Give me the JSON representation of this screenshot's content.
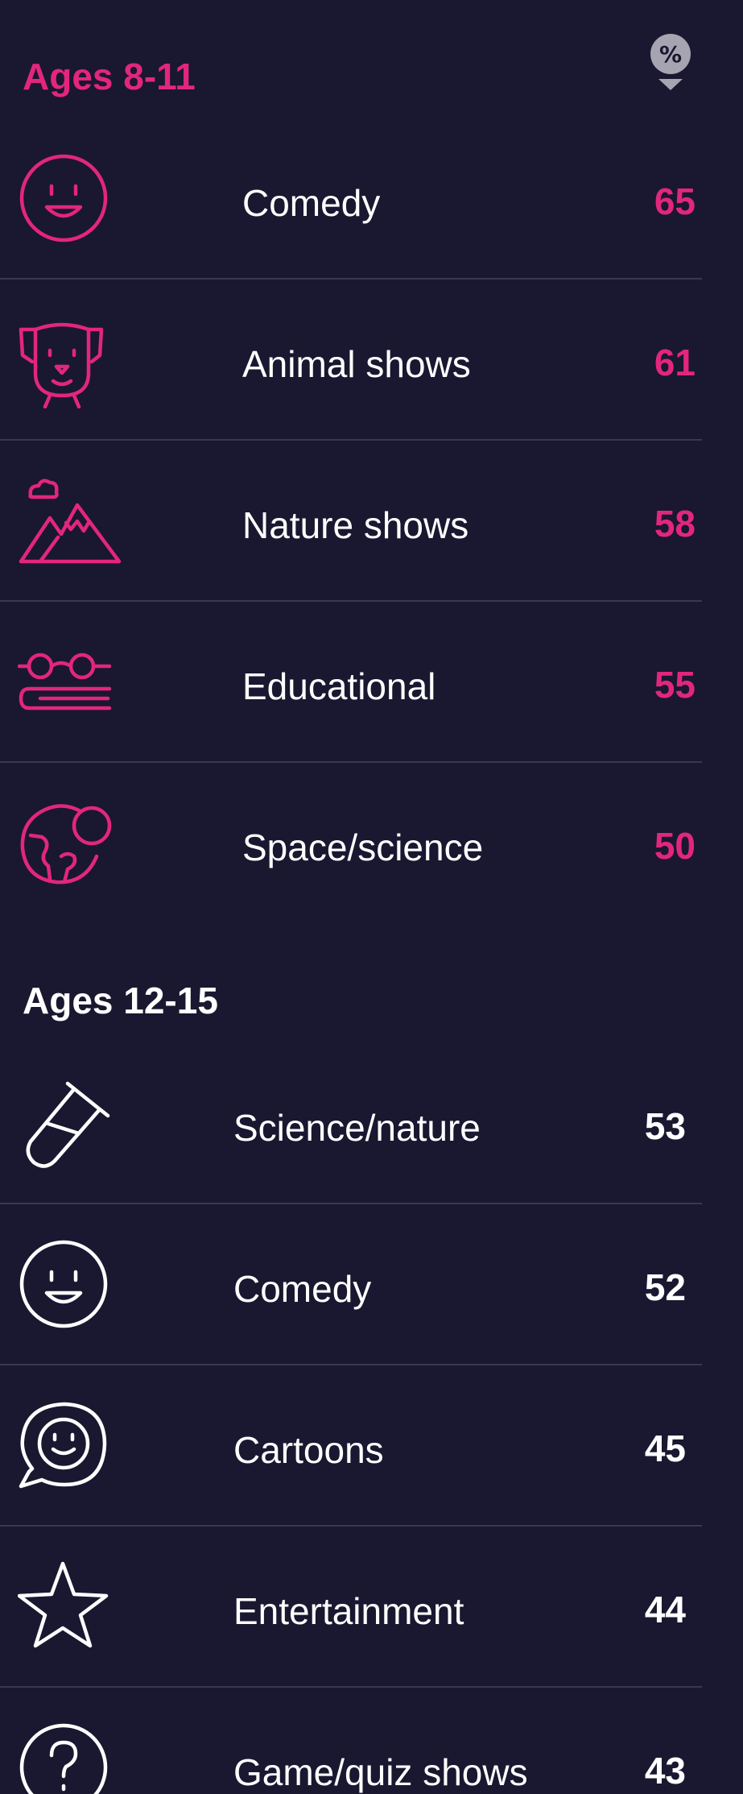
{
  "colors": {
    "background": "#1a1730",
    "accent_pink": "#e2267f",
    "text_white": "#ffffff",
    "divider": "#3a3752",
    "badge_gray": "#a6a4b0"
  },
  "percent_badge": {
    "label": "%"
  },
  "groups": [
    {
      "title": "Ages 8-11",
      "items": [
        {
          "icon": "smiley-face-icon",
          "label": "Comedy",
          "value": "65"
        },
        {
          "icon": "dog-face-icon",
          "label": "Animal shows",
          "value": "61"
        },
        {
          "icon": "mountains-cloud-icon",
          "label": "Nature shows",
          "value": "58"
        },
        {
          "icon": "glasses-book-icon",
          "label": "Educational",
          "value": "55"
        },
        {
          "icon": "planet-globe-icon",
          "label": "Space/science",
          "value": "50"
        }
      ]
    },
    {
      "title": "Ages 12-15",
      "items": [
        {
          "icon": "test-tube-icon",
          "label": "Science/nature",
          "value": "53"
        },
        {
          "icon": "smiley-face-icon",
          "label": "Comedy",
          "value": "52"
        },
        {
          "icon": "speech-bubble-smiley-icon",
          "label": "Cartoons",
          "value": "45"
        },
        {
          "icon": "star-icon",
          "label": "Entertainment",
          "value": "44"
        },
        {
          "icon": "question-mark-icon",
          "label": "Game/quiz shows",
          "value": "43"
        }
      ]
    }
  ]
}
